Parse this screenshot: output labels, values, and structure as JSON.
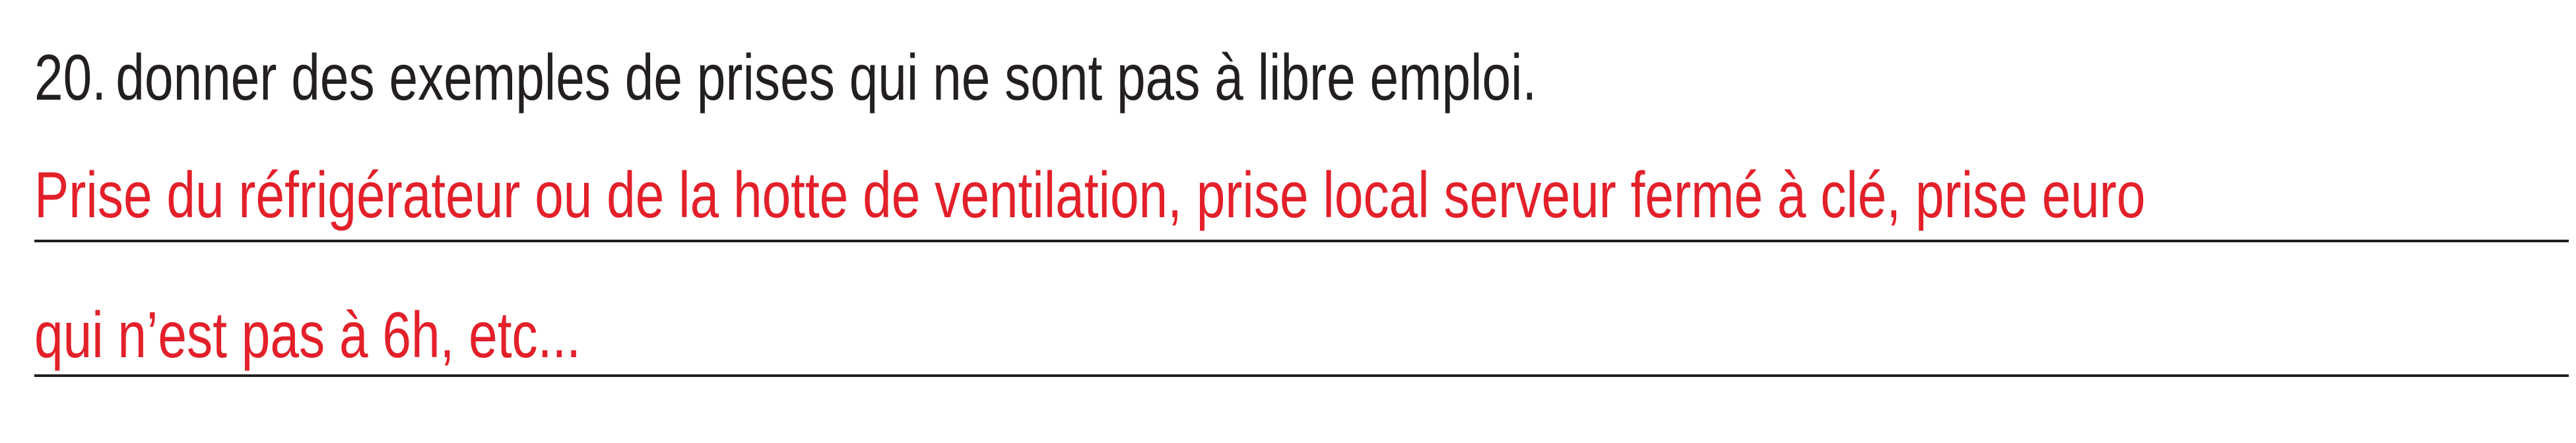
{
  "question": {
    "number": "20.",
    "text": "donner des exemples de prises qui ne sont pas à libre emploi."
  },
  "answer": {
    "lines": [
      "Prise du réfrigérateur ou de la hotte de ventilation, prise local serveur fermé à clé, prise euro",
      "qui n’est pas à 6h, etc..."
    ]
  },
  "colors": {
    "question_text": "#231f20",
    "answer_text": "#e3202a",
    "rule": "#231f20"
  }
}
